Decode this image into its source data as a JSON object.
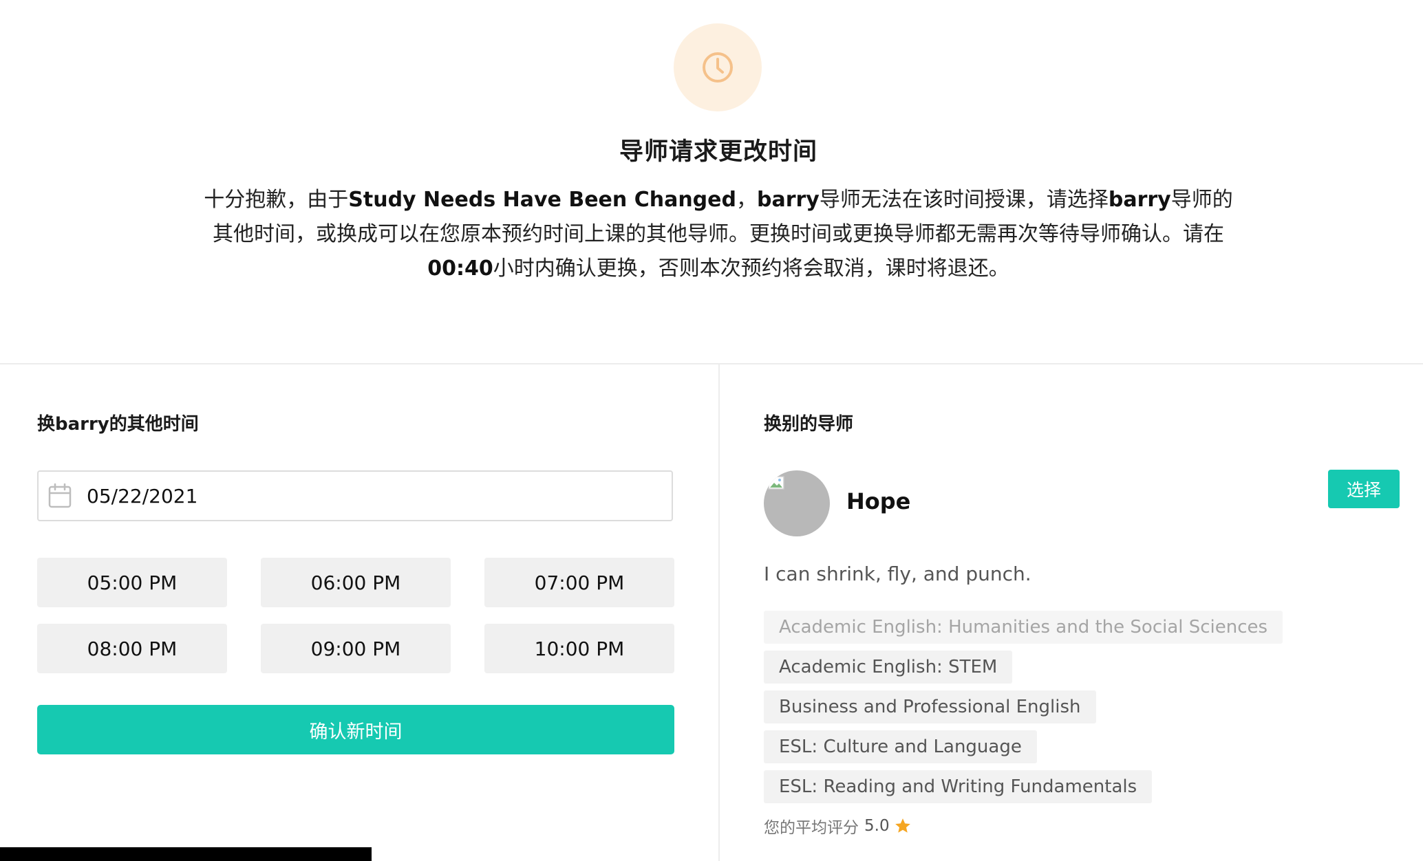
{
  "header": {
    "icon": "clock-icon",
    "icon_bg": "#fdf0e0",
    "icon_color": "#f5c18a",
    "title": "导师请求更改时间",
    "message": {
      "p1": "十分抱歉，由于",
      "reason": "Study Needs Have Been Changed",
      "p2": "，",
      "tutor1": "barry",
      "p3": "导师无法在该时间授课，请选择",
      "tutor2": "barry",
      "p4": "导师的其他时间，或换成可以在您原本预约时间上课的其他导师。更换时间或更换导师都无需再次等待导师确认。请在",
      "deadline": "00:40",
      "p5": "小时内确认更换，否则本次预约将会取消，课时将退还。"
    }
  },
  "left": {
    "section_title": "换barry的其他时间",
    "date_value": "05/22/2021",
    "date_icon": "calendar-icon",
    "slots": [
      "05:00 PM",
      "06:00 PM",
      "07:00 PM",
      "08:00 PM",
      "09:00 PM",
      "10:00 PM"
    ],
    "confirm_label": "确认新时间"
  },
  "right": {
    "section_title": "换别的导师",
    "tutor": {
      "name": "Hope",
      "select_label": "选择",
      "bio": "I can shrink, fly, and punch.",
      "tags": [
        "Academic English: Humanities and the Social Sciences",
        "Academic English: STEM",
        "Business and Professional English",
        "ESL: Culture and Language",
        "ESL: Reading and Writing Fundamentals"
      ],
      "rating_label": "您的平均评分",
      "rating_value": "5.0",
      "rating_icon": "star-icon"
    }
  },
  "colors": {
    "accent": "#16c9b1",
    "slot_bg": "#f0f0f0",
    "star": "#f5a623"
  }
}
